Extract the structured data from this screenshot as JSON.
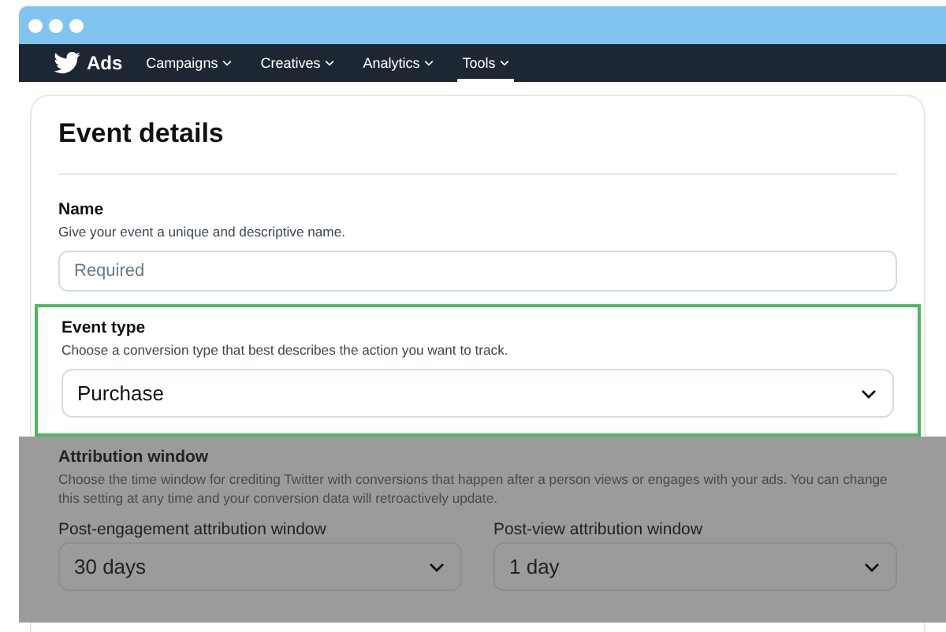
{
  "nav": {
    "brand": "Ads",
    "items": [
      {
        "label": "Campaigns",
        "selected": false
      },
      {
        "label": "Creatives",
        "selected": false
      },
      {
        "label": "Analytics",
        "selected": false
      },
      {
        "label": "Tools",
        "selected": true
      }
    ]
  },
  "card": {
    "title": "Event details",
    "name": {
      "label": "Name",
      "description": "Give your event a unique and descriptive name.",
      "placeholder": "Required"
    },
    "event_type": {
      "label": "Event type",
      "description": "Choose a conversion type that best describes the action you want to track.",
      "value": "Purchase",
      "highlighted": true
    },
    "attribution_window": {
      "label": "Attribution window",
      "description": "Choose the time window for crediting Twitter with conversions that happen after a person views or engages with your ads. You can change this setting at any time and your conversion data will retroactively update.",
      "dimmed": true,
      "selects": [
        {
          "label": "Post-engagement attribution window",
          "value": "30 days"
        },
        {
          "label": "Post-view attribution window",
          "value": "1 day"
        }
      ]
    }
  }
}
